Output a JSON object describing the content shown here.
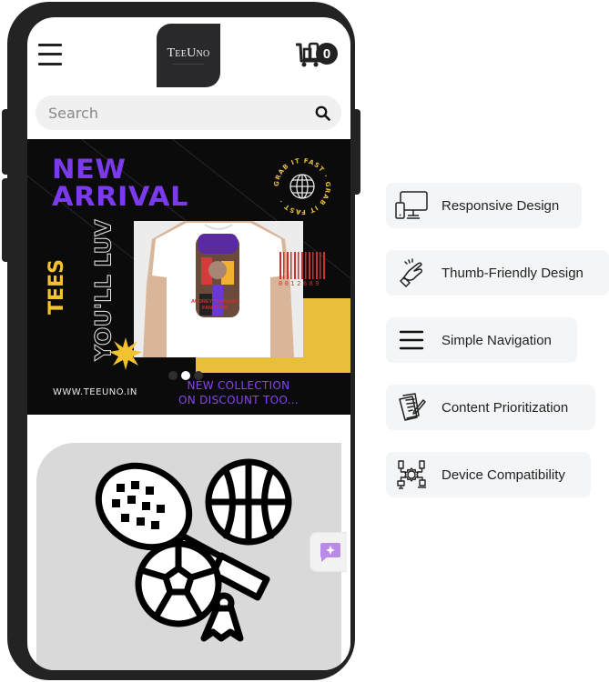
{
  "header": {
    "logo_text": "TeeUno",
    "cart_count": "0"
  },
  "search": {
    "placeholder": "Search",
    "value": ""
  },
  "banner": {
    "headline_line1": "NEW",
    "headline_line2": "ARRIVAL",
    "vertical_tees": "TEES",
    "vertical_tagline": "YOU'LL LUV",
    "badge_text": "GRAB IT FAST · GRAB IT FAST ·",
    "shirt_caption_line1": "AUDREY HEPBURN",
    "shirt_caption_line2": "FAN CLUB",
    "barcode_number": "0012689",
    "website": "WWW.TEEUNO.IN",
    "promo_line1": "NEW COLLECTION",
    "promo_line2": "ON DISCOUNT TOO...",
    "carousel": {
      "total": 3,
      "active_index": 1
    },
    "colors": {
      "purple": "#7b3bed",
      "yellow": "#e7bf3a",
      "red": "#d0302c"
    }
  },
  "category_card": {
    "icon": "sports-equipment-icon"
  },
  "chat_fab": {
    "icon": "ai-chat-icon",
    "color": "#b98ae6"
  },
  "features": [
    {
      "label": "Responsive Design",
      "icon": "responsive-devices-icon"
    },
    {
      "label": "Thumb-Friendly Design",
      "icon": "hand-tap-icon"
    },
    {
      "label": "Simple Navigation",
      "icon": "menu-icon"
    },
    {
      "label": "Content Prioritization",
      "icon": "document-edit-icon"
    },
    {
      "label": "Device Compatibility",
      "icon": "device-network-icon"
    }
  ]
}
